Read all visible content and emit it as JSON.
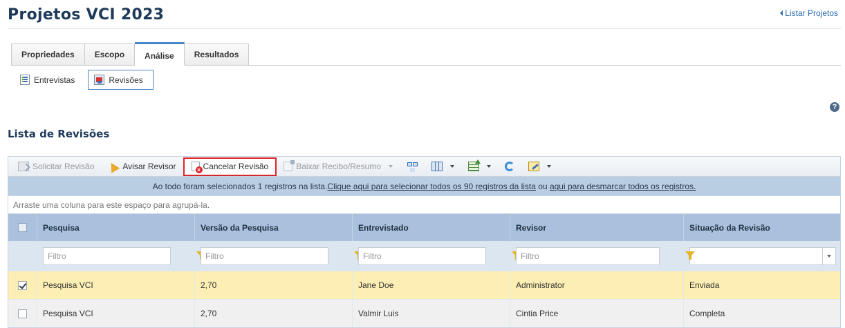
{
  "page": {
    "title": "Projetos VCI 2023",
    "list_projects_link": "Listar Projetos"
  },
  "tabs": [
    {
      "label": "Propriedades"
    },
    {
      "label": "Escopo"
    },
    {
      "label": "Análise",
      "active": true
    },
    {
      "label": "Resultados"
    }
  ],
  "subtabs": [
    {
      "label": "Entrevistas",
      "icon": "spreadsheet-icon"
    },
    {
      "label": "Revisões",
      "icon": "review-icon",
      "active": true
    }
  ],
  "section": {
    "title": "Lista de Revisões"
  },
  "toolbar": {
    "request_review": "Solicitar Revisão",
    "notify_reviewer": "Avisar Revisor",
    "cancel_review": "Cancelar Revisão",
    "download_receipt": "Baixar Recibo/Resumo"
  },
  "info_bar": {
    "text": "Ao todo foram selecionados 1 registros na lista. ",
    "select_all_link": "Clique aqui para selecionar todos os 90 registros da lista",
    "middle": " ou ",
    "deselect_link": "aqui para desmarcar todos os registros."
  },
  "group_hint": "Arraste uma coluna para este espaço para agrupá-la.",
  "columns": [
    "Pesquisa",
    "Versão da Pesquisa",
    "Entrevistado",
    "Revisor",
    "Situação da Revisão"
  ],
  "filter_placeholder": "Filtro",
  "rows": [
    {
      "checked": true,
      "pesquisa": "Pesquisa VCI",
      "versao": "2,70",
      "entrevistado": "Jane Doe",
      "revisor": "Administrator",
      "situacao": "Enviada"
    },
    {
      "checked": false,
      "pesquisa": "Pesquisa VCI",
      "versao": "2,70",
      "entrevistado": "Valmir Luis",
      "revisor": "Cintia Price",
      "situacao": "Completa"
    }
  ],
  "colors": {
    "title": "#1e3a5a",
    "link": "#2a6eb5",
    "header_bg": "#a9c1dd",
    "selected_row": "#fdeeb4",
    "highlight_border": "#d9262c"
  }
}
